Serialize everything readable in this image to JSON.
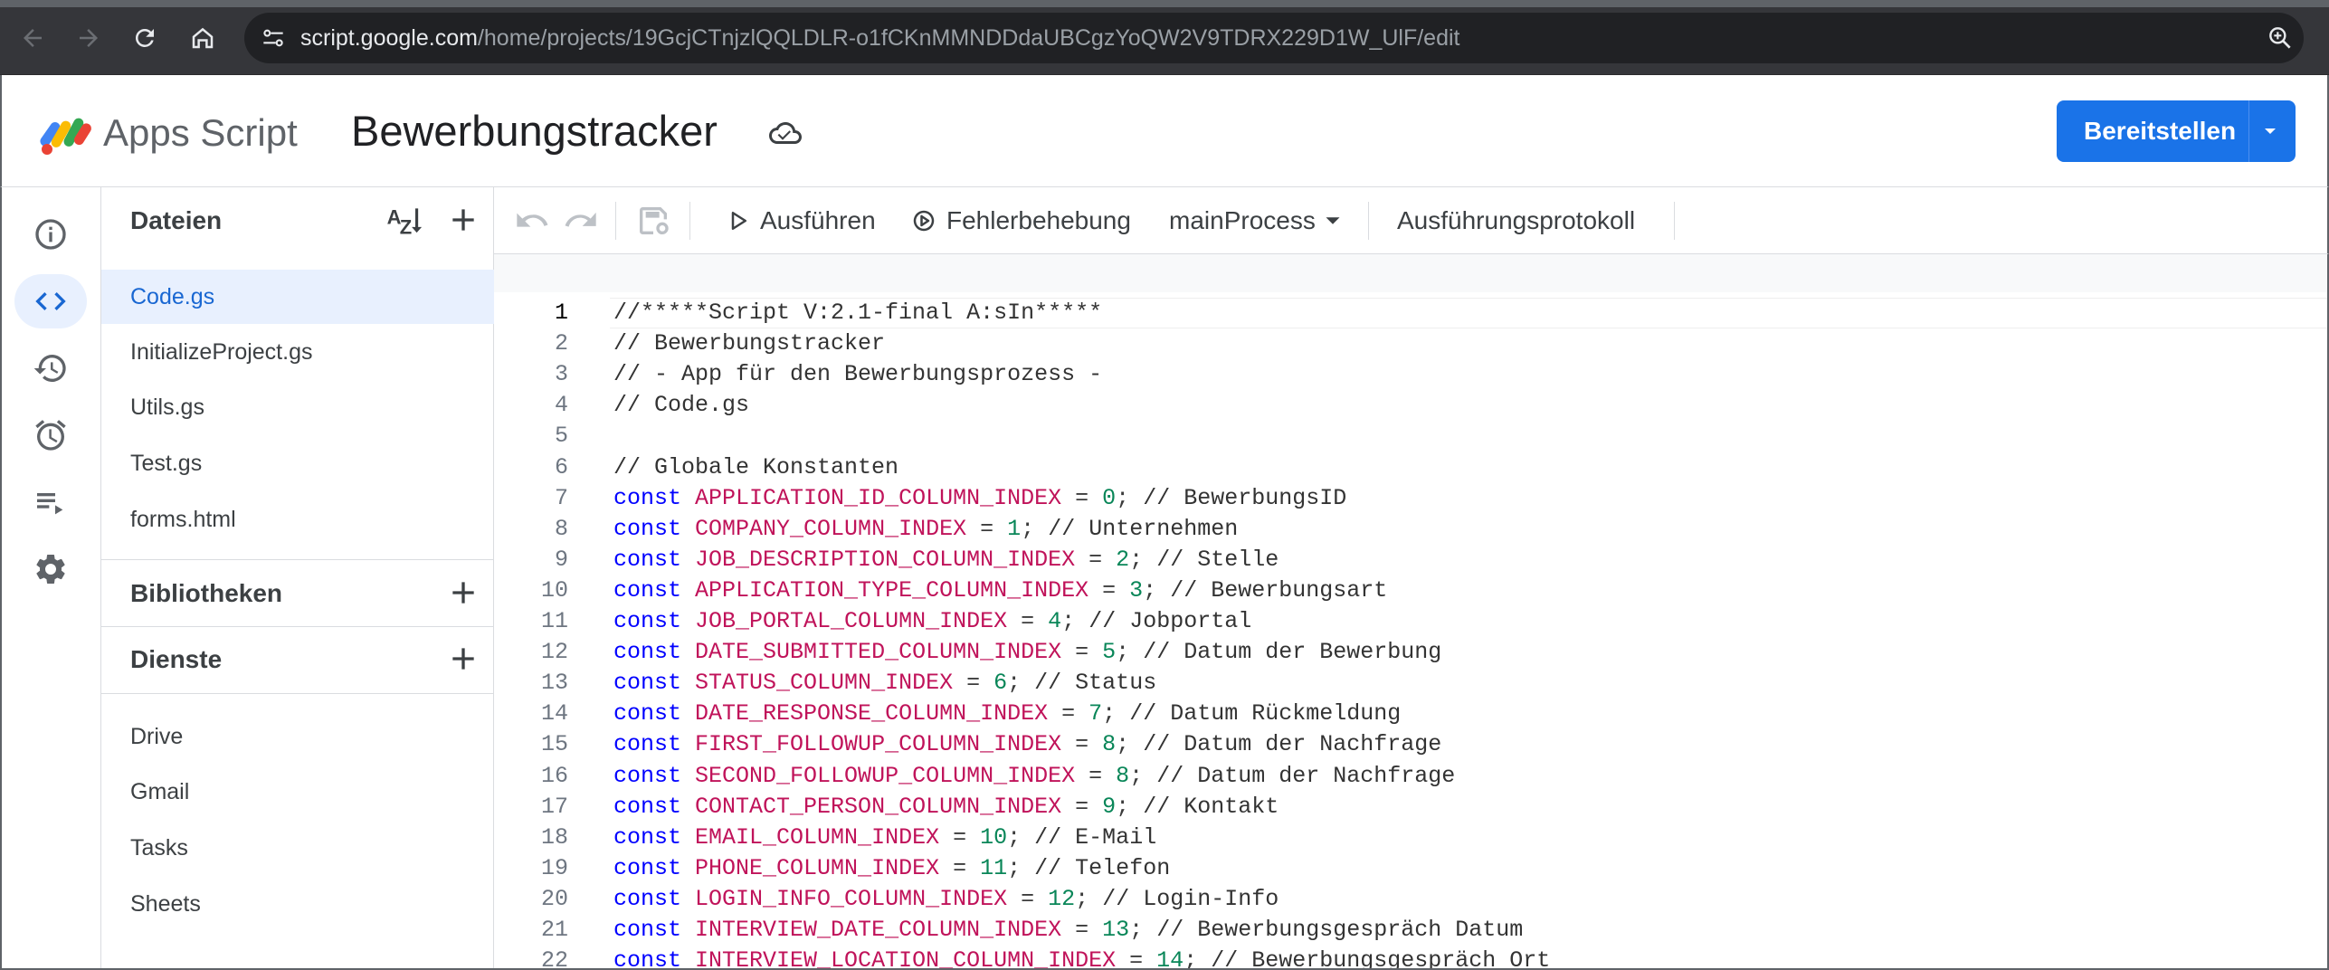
{
  "browser": {
    "url_host": "script.google.com",
    "url_path": "/home/projects/19GcjCTnjzlQQLDLR-o1fCKnMMNDDdaUBCgzYoQW2V9TDRX229D1W_UlF/edit"
  },
  "header": {
    "product_name": "Apps Script",
    "project_title": "Bewerbungstracker",
    "deploy_label": "Bereitstellen"
  },
  "files_panel": {
    "files_title": "Dateien",
    "files": [
      {
        "name": "Code.gs",
        "active": true
      },
      {
        "name": "InitializeProject.gs",
        "active": false
      },
      {
        "name": "Utils.gs",
        "active": false
      },
      {
        "name": "Test.gs",
        "active": false
      },
      {
        "name": "forms.html",
        "active": false
      }
    ],
    "libraries_title": "Bibliotheken",
    "services_title": "Dienste",
    "services": [
      "Drive",
      "Gmail",
      "Tasks",
      "Sheets"
    ]
  },
  "toolbar": {
    "run_label": "Ausführen",
    "debug_label": "Fehlerbehebung",
    "function_select": "mainProcess",
    "log_label": "Ausführungsprotokoll"
  },
  "code": {
    "line_numbers": [
      "1",
      "2",
      "3",
      "4",
      "5",
      "6",
      "7",
      "8",
      "9",
      "10",
      "11",
      "12",
      "13",
      "14",
      "15",
      "16",
      "17",
      "18",
      "19",
      "20",
      "21",
      "22"
    ],
    "comment_lines": [
      "//*****Script V:2.1-final A:sIn*****",
      "// Bewerbungstracker",
      "// - App für den Bewerbungsprozess -",
      "// Code.gs",
      "",
      "// Globale Konstanten"
    ],
    "const_keyword": "const",
    "declarations": [
      {
        "name": "APPLICATION_ID_COLUMN_INDEX",
        "value": "0",
        "comment": "// BewerbungsID"
      },
      {
        "name": "COMPANY_COLUMN_INDEX",
        "value": "1",
        "comment": "// Unternehmen"
      },
      {
        "name": "JOB_DESCRIPTION_COLUMN_INDEX",
        "value": "2",
        "comment": "// Stelle"
      },
      {
        "name": "APPLICATION_TYPE_COLUMN_INDEX",
        "value": "3",
        "comment": "// Bewerbungsart"
      },
      {
        "name": "JOB_PORTAL_COLUMN_INDEX",
        "value": "4",
        "comment": "// Jobportal"
      },
      {
        "name": "DATE_SUBMITTED_COLUMN_INDEX",
        "value": "5",
        "comment": "// Datum der Bewerbung"
      },
      {
        "name": "STATUS_COLUMN_INDEX",
        "value": "6",
        "comment": "// Status"
      },
      {
        "name": "DATE_RESPONSE_COLUMN_INDEX",
        "value": "7",
        "comment": "// Datum Rückmeldung"
      },
      {
        "name": "FIRST_FOLLOWUP_COLUMN_INDEX",
        "value": "8",
        "comment": "// Datum der Nachfrage"
      },
      {
        "name": "SECOND_FOLLOWUP_COLUMN_INDEX",
        "value": "8",
        "comment": "// Datum der Nachfrage"
      },
      {
        "name": "CONTACT_PERSON_COLUMN_INDEX",
        "value": "9",
        "comment": "// Kontakt"
      },
      {
        "name": "EMAIL_COLUMN_INDEX",
        "value": "10",
        "comment": "// E-Mail"
      },
      {
        "name": "PHONE_COLUMN_INDEX",
        "value": "11",
        "comment": "// Telefon"
      },
      {
        "name": "LOGIN_INFO_COLUMN_INDEX",
        "value": "12",
        "comment": "// Login-Info"
      },
      {
        "name": "INTERVIEW_DATE_COLUMN_INDEX",
        "value": "13",
        "comment": "// Bewerbungsgespräch Datum"
      },
      {
        "name": "INTERVIEW_LOCATION_COLUMN_INDEX",
        "value": "14",
        "comment": "// Bewerbungsgespräch Ort"
      }
    ],
    "assign_op": "=",
    "terminator": ";"
  },
  "colors": {
    "accent": "#1a73e8",
    "active_bg": "#e8f0fe",
    "keyword": "#0000ff",
    "identifier": "#c0135a",
    "number": "#098658"
  }
}
